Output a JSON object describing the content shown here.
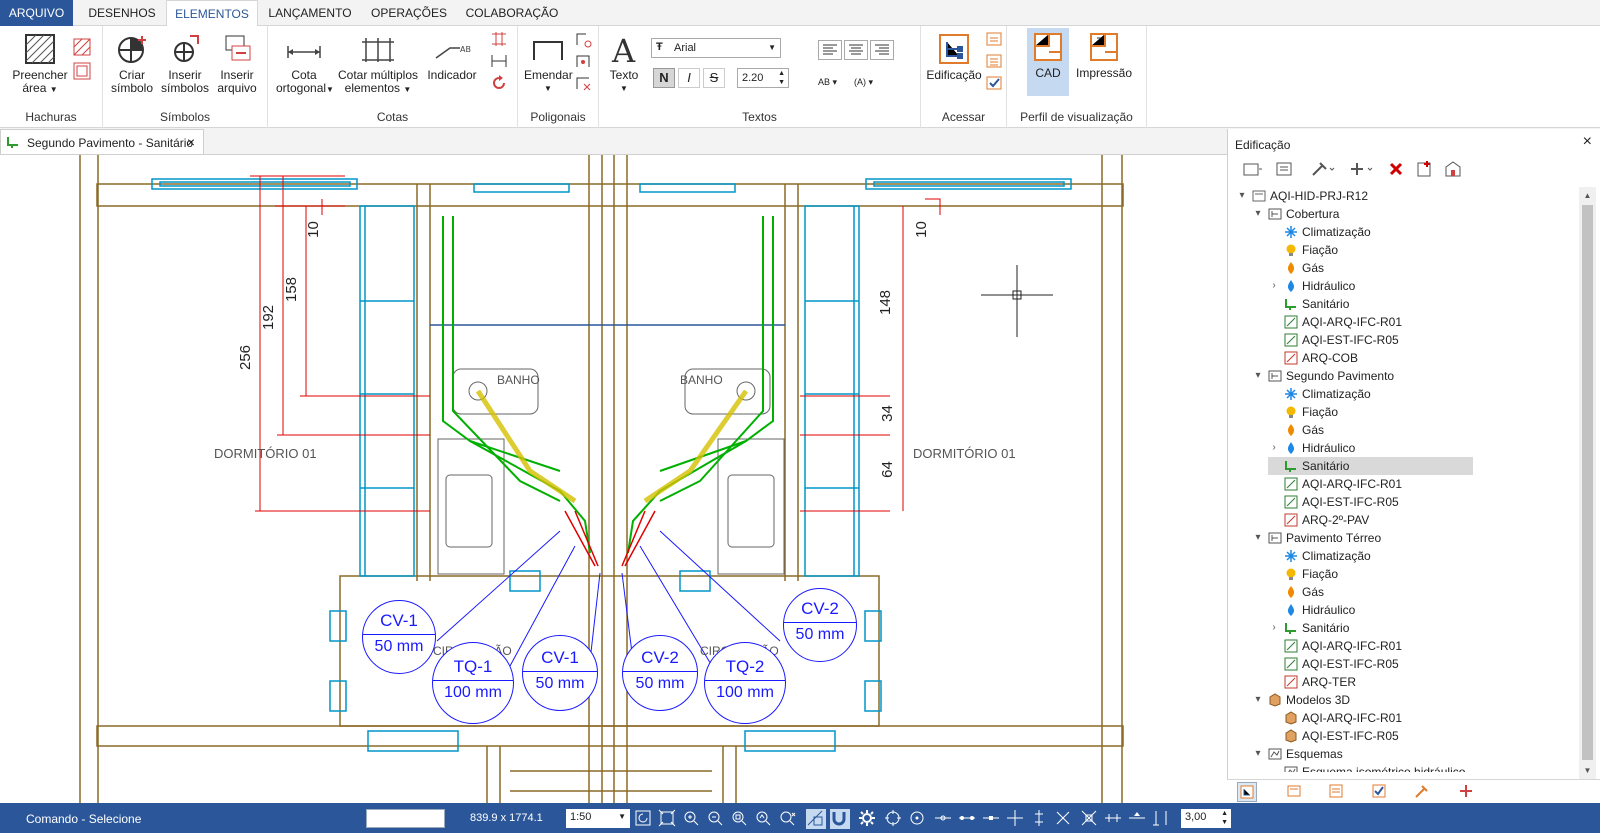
{
  "menu_tabs": [
    {
      "label": "ARQUIVO"
    },
    {
      "label": "DESENHOS"
    },
    {
      "label": "ELEMENTOS"
    },
    {
      "label": "LANÇAMENTO"
    },
    {
      "label": "OPERAÇÕES"
    },
    {
      "label": "COLABORAÇÃO"
    }
  ],
  "ribbon": {
    "hachuras": {
      "group": "Hachuras",
      "preencher": "Preencher área"
    },
    "simbolos": {
      "group": "Símbolos",
      "criar": "Criar símbolo",
      "inserir": "Inserir símbolos",
      "inserir_arquivo": "Inserir arquivo"
    },
    "cotas": {
      "group": "Cotas",
      "cota_ortogonal": "Cota ortogonal",
      "cotar_multiplos": "Cotar múltiplos elementos",
      "indicador": "Indicador"
    },
    "poligonais": {
      "group": "Poligonais",
      "emendar": "Emendar"
    },
    "textos": {
      "group": "Textos",
      "texto": "Texto",
      "font": "Arial",
      "size": "2.20"
    },
    "acessar": {
      "group": "Acessar",
      "edificacao": "Edificação"
    },
    "perfil": {
      "group": "Perfil de visualização",
      "cad": "CAD",
      "impressao": "Impressão"
    }
  },
  "document_tab": {
    "title": "Segundo Pavimento - Sanitário"
  },
  "drawing": {
    "rooms": {
      "dorm_left": "DORMITÓRIO 01",
      "dorm_right": "DORMITÓRIO 01",
      "banho_left": "BANHO",
      "banho_right": "BANHO",
      "circ_left": "CIRCULAÇÃO",
      "circ_right": "CIRCULAÇÃO"
    },
    "dims_left": [
      "10",
      "158",
      "192",
      "256"
    ],
    "dims_right": [
      "10",
      "148",
      "34",
      "64"
    ],
    "tags": [
      {
        "code": "CV-1",
        "size": "50 mm"
      },
      {
        "code": "TQ-1",
        "size": "100 mm"
      },
      {
        "code": "CV-1",
        "size": "50 mm"
      },
      {
        "code": "CV-2",
        "size": "50 mm"
      },
      {
        "code": "TQ-2",
        "size": "100 mm"
      },
      {
        "code": "CV-2",
        "size": "50 mm"
      }
    ]
  },
  "panel": {
    "title": "Edificação",
    "tree": [
      {
        "label": "AQI-HID-PRJ-R12",
        "icon": "project-icon"
      },
      {
        "label": "Cobertura",
        "icon": "floor-icon"
      },
      {
        "label": "Climatização",
        "icon": "snowflake-icon"
      },
      {
        "label": "Fiação",
        "icon": "bulb-icon"
      },
      {
        "label": "Gás",
        "icon": "flame-icon"
      },
      {
        "label": "Hidráulico",
        "icon": "drop-icon"
      },
      {
        "label": "Sanitário",
        "icon": "sanitary-icon"
      },
      {
        "label": "AQI-ARQ-IFC-R01",
        "icon": "ifc-icon"
      },
      {
        "label": "AQI-EST-IFC-R05",
        "icon": "ifc-icon"
      },
      {
        "label": "ARQ-COB",
        "icon": "dwg-icon"
      },
      {
        "label": "Segundo Pavimento",
        "icon": "floor-icon"
      },
      {
        "label": "Climatização",
        "icon": "snowflake-icon"
      },
      {
        "label": "Fiação",
        "icon": "bulb-icon"
      },
      {
        "label": "Gás",
        "icon": "flame-icon"
      },
      {
        "label": "Hidráulico",
        "icon": "drop-icon"
      },
      {
        "label": "Sanitário",
        "icon": "sanitary-icon"
      },
      {
        "label": "AQI-ARQ-IFC-R01",
        "icon": "ifc-icon"
      },
      {
        "label": "AQI-EST-IFC-R05",
        "icon": "ifc-icon"
      },
      {
        "label": "ARQ-2º-PAV",
        "icon": "dwg-icon"
      },
      {
        "label": "Pavimento Térreo",
        "icon": "floor-icon"
      },
      {
        "label": "Climatização",
        "icon": "snowflake-icon"
      },
      {
        "label": "Fiação",
        "icon": "bulb-icon"
      },
      {
        "label": "Gás",
        "icon": "flame-icon"
      },
      {
        "label": "Hidráulico",
        "icon": "drop-icon"
      },
      {
        "label": "Sanitário",
        "icon": "sanitary-icon"
      },
      {
        "label": "AQI-ARQ-IFC-R01",
        "icon": "ifc-icon"
      },
      {
        "label": "AQI-EST-IFC-R05",
        "icon": "ifc-icon"
      },
      {
        "label": "ARQ-TER",
        "icon": "dwg-icon"
      },
      {
        "label": "Modelos 3D",
        "icon": "model3d-icon"
      },
      {
        "label": "AQI-ARQ-IFC-R01",
        "icon": "model3d-icon"
      },
      {
        "label": "AQI-EST-IFC-R05",
        "icon": "model3d-icon"
      },
      {
        "label": "Esquemas",
        "icon": "schema-icon"
      },
      {
        "label": "Esquema isométrico hidráulico",
        "icon": "schema-icon"
      }
    ],
    "selected": "Sanitário (Segundo Pavimento)"
  },
  "status": {
    "command": "Comando - Selecione",
    "coords": "839.9 x 1774.1",
    "scale": "1:50",
    "value": "3,00"
  },
  "colors": {
    "brand": "#2b579a",
    "dim_red": "#e00000",
    "pipe_green": "#00b000",
    "tag_blue": "#1a1aff",
    "wall": "#8b6a28",
    "window": "#0095c8"
  }
}
